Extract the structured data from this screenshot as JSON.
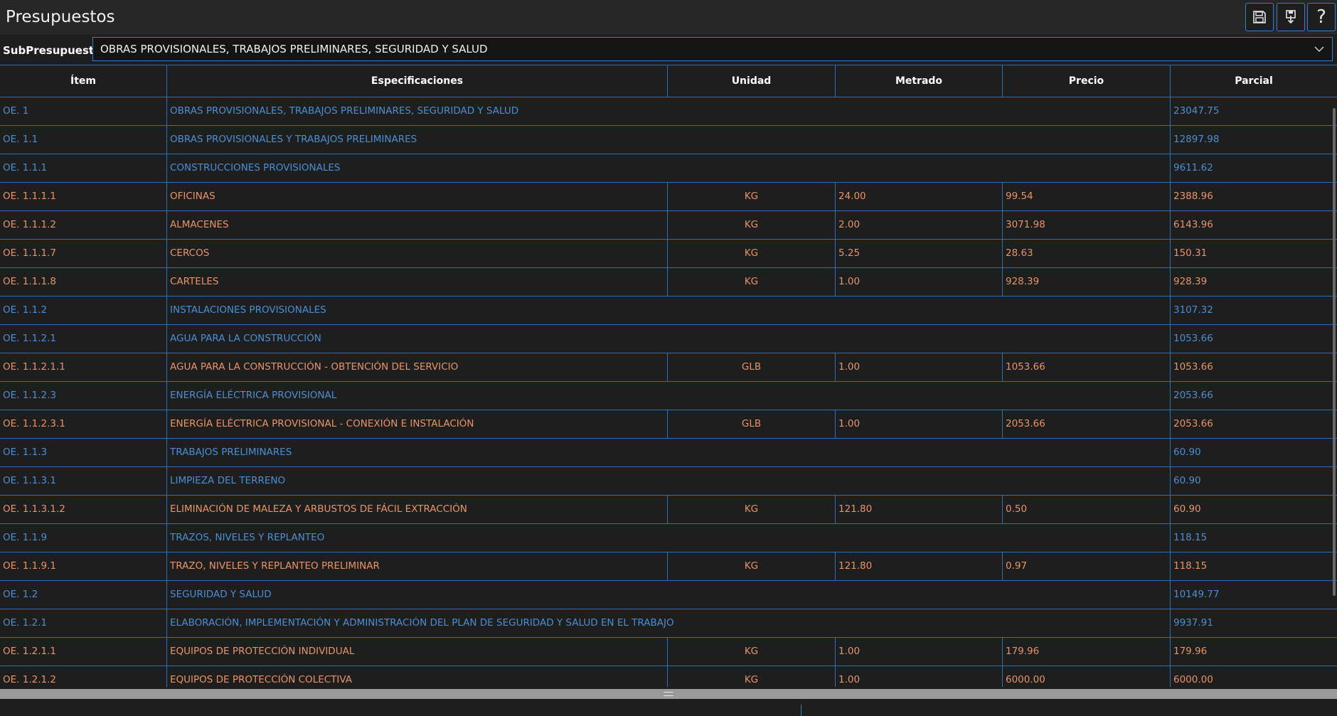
{
  "window": {
    "title": "Presupuestos",
    "buttons": [
      {
        "icon": "save-icon"
      },
      {
        "icon": "export-icon"
      },
      {
        "icon": "help-icon",
        "label": "?"
      }
    ]
  },
  "subpresupuesto": {
    "label": "SubPresupuesto:",
    "value": "OBRAS PROVISIONALES, TRABAJOS PRELIMINARES, SEGURIDAD Y SALUD"
  },
  "table": {
    "headers": {
      "item": "Ítem",
      "spec": "Especificaciones",
      "unit": "Unidad",
      "metrado": "Metrado",
      "precio": "Precio",
      "parcial": "Parcial"
    },
    "rows": [
      {
        "type": "group",
        "item": "OE. 1",
        "spec": "OBRAS PROVISIONALES, TRABAJOS PRELIMINARES, SEGURIDAD Y SALUD",
        "parcial": "23047.75"
      },
      {
        "type": "group",
        "item": "OE. 1.1",
        "spec": "OBRAS PROVISIONALES Y TRABAJOS PRELIMINARES",
        "parcial": "12897.98"
      },
      {
        "type": "group",
        "item": "OE. 1.1.1",
        "spec": "CONSTRUCCIONES PROVISIONALES",
        "parcial": "9611.62"
      },
      {
        "type": "leaf",
        "item": "OE. 1.1.1.1",
        "spec": "OFICINAS",
        "unit": "KG",
        "metrado": "24.00",
        "precio": "99.54",
        "parcial": "2388.96"
      },
      {
        "type": "leaf",
        "item": "OE. 1.1.1.2",
        "spec": "ALMACENES",
        "unit": "KG",
        "metrado": "2.00",
        "precio": "3071.98",
        "parcial": "6143.96"
      },
      {
        "type": "leaf",
        "item": "OE. 1.1.1.7",
        "spec": "CERCOS",
        "unit": "KG",
        "metrado": "5.25",
        "precio": "28.63",
        "parcial": "150.31"
      },
      {
        "type": "leaf",
        "item": "OE. 1.1.1.8",
        "spec": "CARTELES",
        "unit": "KG",
        "metrado": "1.00",
        "precio": "928.39",
        "parcial": "928.39"
      },
      {
        "type": "group",
        "item": "OE. 1.1.2",
        "spec": "INSTALACIONES PROVISIONALES",
        "parcial": "3107.32"
      },
      {
        "type": "group",
        "item": "OE. 1.1.2.1",
        "spec": "AGUA PARA LA CONSTRUCCIÓN",
        "parcial": "1053.66"
      },
      {
        "type": "leaf",
        "item": "OE. 1.1.2.1.1",
        "spec": "AGUA PARA LA CONSTRUCCIÓN - OBTENCIÓN DEL SERVICIO",
        "unit": "GLB",
        "metrado": "1.00",
        "precio": "1053.66",
        "parcial": "1053.66"
      },
      {
        "type": "group",
        "item": "OE. 1.1.2.3",
        "spec": "ENERGÍA ELÉCTRICA PROVISIONAL",
        "parcial": "2053.66"
      },
      {
        "type": "leaf",
        "item": "OE. 1.1.2.3.1",
        "spec": "ENERGÍA ELÉCTRICA PROVISIONAL - CONEXIÓN E INSTALACIÓN",
        "unit": "GLB",
        "metrado": "1.00",
        "precio": "2053.66",
        "parcial": "2053.66"
      },
      {
        "type": "group",
        "item": "OE. 1.1.3",
        "spec": "TRABAJOS PRELIMINARES",
        "parcial": "60.90"
      },
      {
        "type": "group",
        "item": "OE. 1.1.3.1",
        "spec": "LIMPIEZA DEL TERRENO",
        "parcial": "60.90"
      },
      {
        "type": "leaf",
        "item": "OE. 1.1.3.1.2",
        "spec": "ELIMINACIÓN DE MALEZA Y ARBUSTOS DE FÁCIL EXTRACCIÓN",
        "unit": "KG",
        "metrado": "121.80",
        "precio": "0.50",
        "parcial": "60.90"
      },
      {
        "type": "group",
        "item": "OE. 1.1.9",
        "spec": "TRAZOS, NIVELES Y REPLANTEO",
        "parcial": "118.15"
      },
      {
        "type": "leaf",
        "item": "OE. 1.1.9.1",
        "spec": "TRAZO, NIVELES Y REPLANTEO PRELIMINAR",
        "unit": "KG",
        "metrado": "121.80",
        "precio": "0.97",
        "parcial": "118.15"
      },
      {
        "type": "group",
        "item": "OE. 1.2",
        "spec": "SEGURIDAD Y SALUD",
        "parcial": "10149.77"
      },
      {
        "type": "group",
        "item": "OE. 1.2.1",
        "spec": "ELABORACIÓN, IMPLEMENTACIÓN Y ADMINISTRACIÓN DEL PLAN DE SEGURIDAD Y SALUD EN EL TRABAJO",
        "parcial": "9937.91"
      },
      {
        "type": "leaf",
        "item": "OE. 1.2.1.1",
        "spec": "EQUIPOS DE PROTECCIÓN INDIVIDUAL",
        "unit": "KG",
        "metrado": "1.00",
        "precio": "179.96",
        "parcial": "179.96"
      },
      {
        "type": "leaf",
        "item": "OE. 1.2.1.2",
        "spec": "EQUIPOS DE PROTECCIÓN COLECTIVA",
        "unit": "KG",
        "metrado": "1.00",
        "precio": "6000.00",
        "parcial": "6000.00"
      }
    ]
  }
}
